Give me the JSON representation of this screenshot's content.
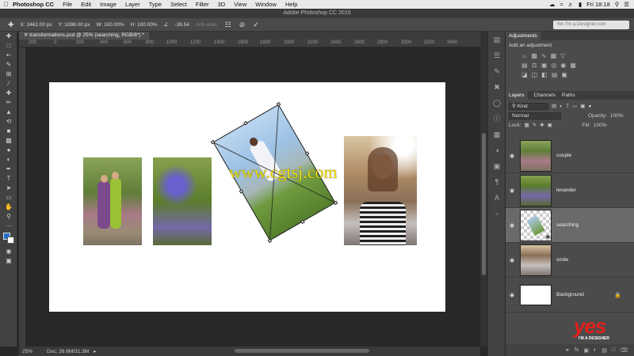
{
  "menubar": {
    "app": "Photoshop CC",
    "items": [
      "File",
      "Edit",
      "Image",
      "Layer",
      "Type",
      "Select",
      "Filter",
      "3D",
      "View",
      "Window",
      "Help"
    ],
    "clock": "Fri 18:18"
  },
  "window": {
    "title": "Adobe Photoshop CC 2015"
  },
  "options": {
    "x": "X: 2462.00 px",
    "y": "Y: 1098.00 px",
    "w": "W: 100.00%",
    "h": "H: 100.00%",
    "angle": "-26.54",
    "anti_alias": "Anti-alias",
    "search_placeholder": "Yes I'm a Designer.com"
  },
  "document": {
    "tab": "transformations.psd @ 25% (searching, RGB/8*) *"
  },
  "ruler": {
    "ticks": [
      "200",
      "0",
      "200",
      "400",
      "600",
      "800",
      "1000",
      "1200",
      "1400",
      "1600",
      "1800",
      "2000",
      "2200",
      "2400",
      "2600",
      "2800",
      "3000",
      "3200",
      "3400"
    ]
  },
  "canvas": {
    "watermark": "www.cgtsj.com"
  },
  "status": {
    "zoom": "25%",
    "doc": "Doc: 26.6M/31.3M"
  },
  "adjustments": {
    "tab": "Adjustments",
    "subtitle": "Add an adjustment"
  },
  "layers_panel": {
    "tabs": [
      "Layers",
      "Channels",
      "Paths"
    ],
    "filter_kind": "Kind",
    "blend_mode": "Normal",
    "opacity_label": "Opacity:",
    "opacity_value": "100%",
    "lock_label": "Lock:",
    "fill_label": "Fill:",
    "fill_value": "100%",
    "layers": [
      {
        "name": "couple"
      },
      {
        "name": "levander"
      },
      {
        "name": "searching"
      },
      {
        "name": "smile"
      },
      {
        "name": "Background"
      }
    ]
  },
  "brand": {
    "logo_word": "yes",
    "logo_tag": "I'M A DESIGNER"
  }
}
